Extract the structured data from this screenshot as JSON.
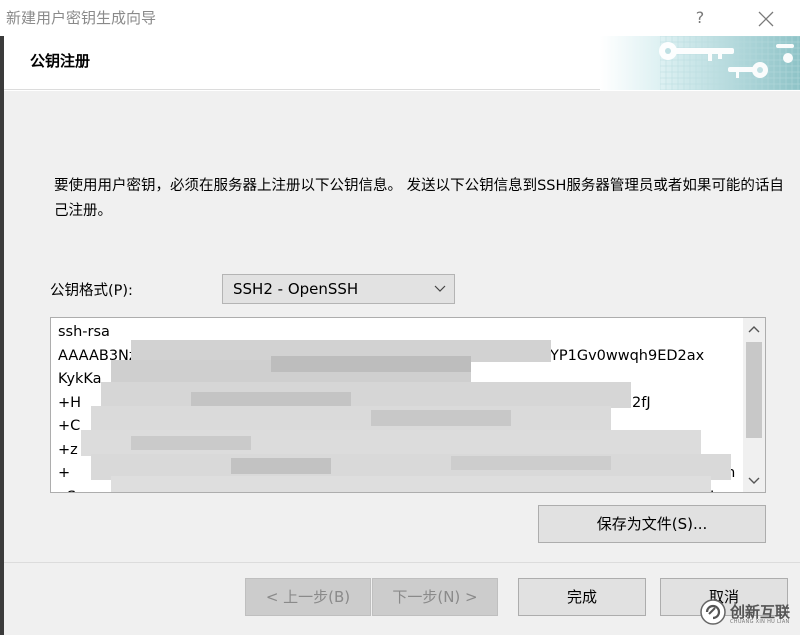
{
  "window": {
    "title": "新建用户密钥生成向导",
    "help_label": "?"
  },
  "header": {
    "title": "公钥注册"
  },
  "content": {
    "description": "要使用用户密钥，必须在服务器上注册以下公钥信息。 发送以下公钥信息到SSH服务器管理员或者如果可能的话自己注册。",
    "format_label": "公钥格式(P):",
    "format_value": "SSH2 - OpenSSH",
    "key_lines": [
      "ssh-rsa",
      "AAAAB3Nz",
      "KykKa",
      "+H",
      "+C",
      "+z",
      "+",
      "oS"
    ],
    "key_line_tails": [
      "",
      "fHYP1Gv0wwqh9ED2ax",
      "",
      "2fJ",
      "",
      "",
      "/r4n",
      "I"
    ],
    "save_button": "保存为文件(S)..."
  },
  "footer": {
    "back_button": "< 上一步(B)",
    "next_button": "下一步(N) >",
    "finish_button": "完成",
    "cancel_button": "取消"
  },
  "watermark": {
    "brand": "创新互联",
    "subtitle": "CHUANG XIN HU LIAN"
  }
}
